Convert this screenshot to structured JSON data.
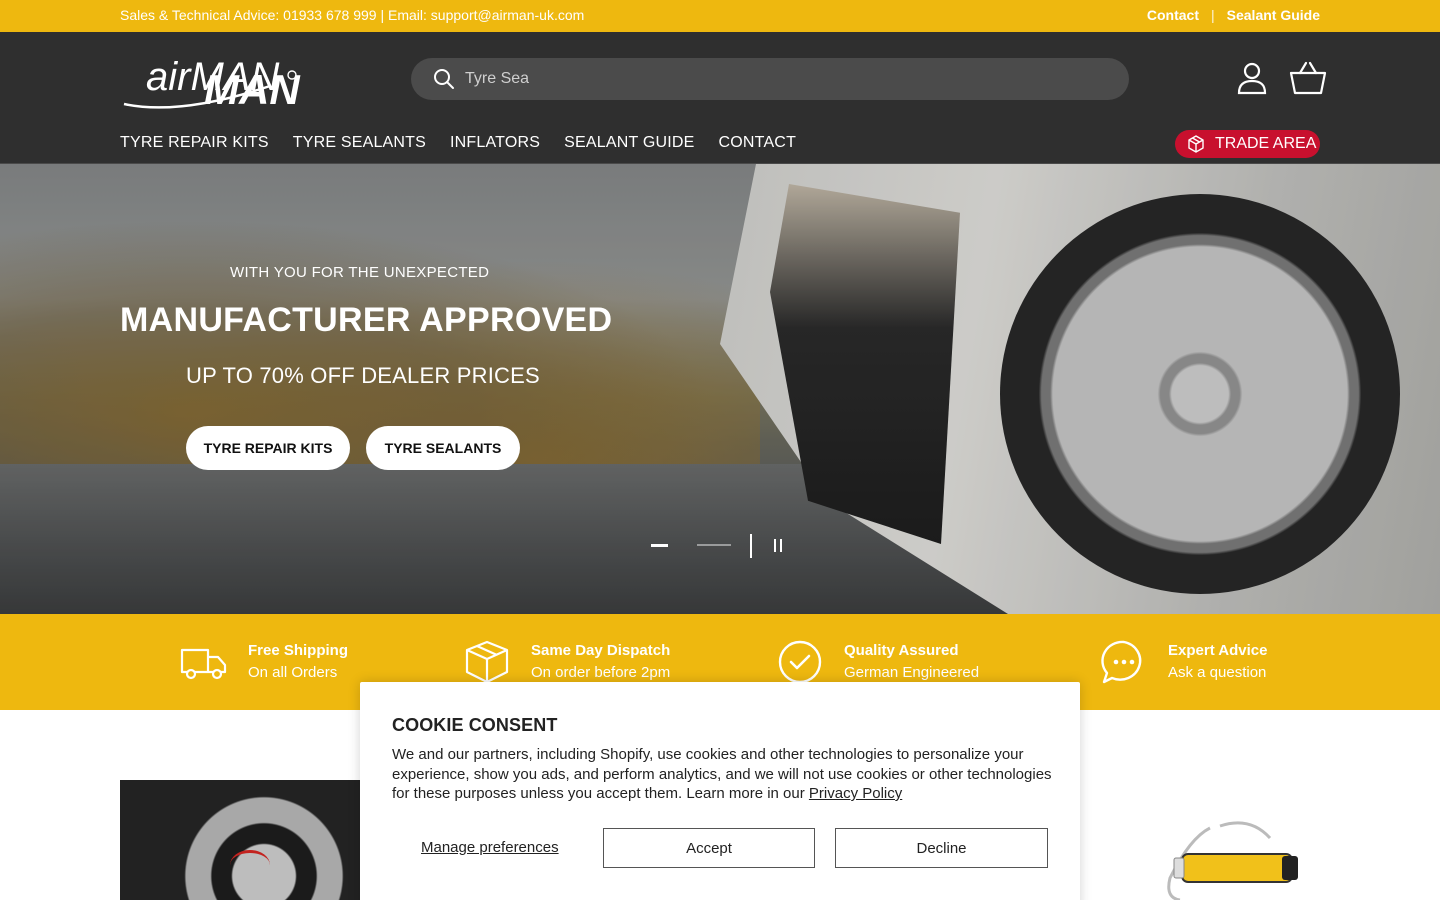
{
  "topbar": {
    "advice": "Sales & Technical Advice: 01933 678 999 | Email: support@airman-uk.com",
    "links": [
      "Contact",
      "Sealant Guide"
    ],
    "separator": "|"
  },
  "header": {
    "logo_text": "airMAN",
    "search_value": "Tyre Sea",
    "icons": [
      "search-icon",
      "account-icon",
      "basket-icon"
    ],
    "nav": [
      "TYRE REPAIR KITS",
      "TYRE SEALANTS",
      "INFLATORS",
      "SEALANT GUIDE",
      "CONTACT"
    ],
    "trade_area": "TRADE AREA"
  },
  "hero": {
    "eyebrow": "WITH YOU FOR THE UNEXPECTED",
    "headline": "MANUFACTURER APPROVED",
    "subheading": "UP TO 70% OFF DEALER PRICES",
    "buttons": [
      "TYRE REPAIR KITS",
      "TYRE SEALANTS"
    ],
    "slides_total": 2,
    "active_slide": 1
  },
  "usp": [
    {
      "icon": "truck-icon",
      "title": "Free Shipping",
      "text": "On all Orders"
    },
    {
      "icon": "box-icon",
      "title": "Same Day Dispatch",
      "text": "On order before 2pm"
    },
    {
      "icon": "check-circle-icon",
      "title": "Quality Assured",
      "text": "German Engineered"
    },
    {
      "icon": "chat-icon",
      "title": "Expert Advice",
      "text": "Ask a question"
    }
  ],
  "cookie": {
    "title": "COOKIE CONSENT",
    "body": "We and our partners, including Shopify, use cookies and other technologies to personalize your experience, show you ads, and perform analytics, and we will not use cookies or other technologies for these purposes unless you accept them. Learn more in our ",
    "privacy_link": "Privacy Policy",
    "manage": "Manage preferences",
    "accept": "Accept",
    "decline": "Decline"
  },
  "colors": {
    "brand_yellow": "#eeb80f",
    "header_dark": "#2f2f2f",
    "trade_red": "#c8102e"
  }
}
